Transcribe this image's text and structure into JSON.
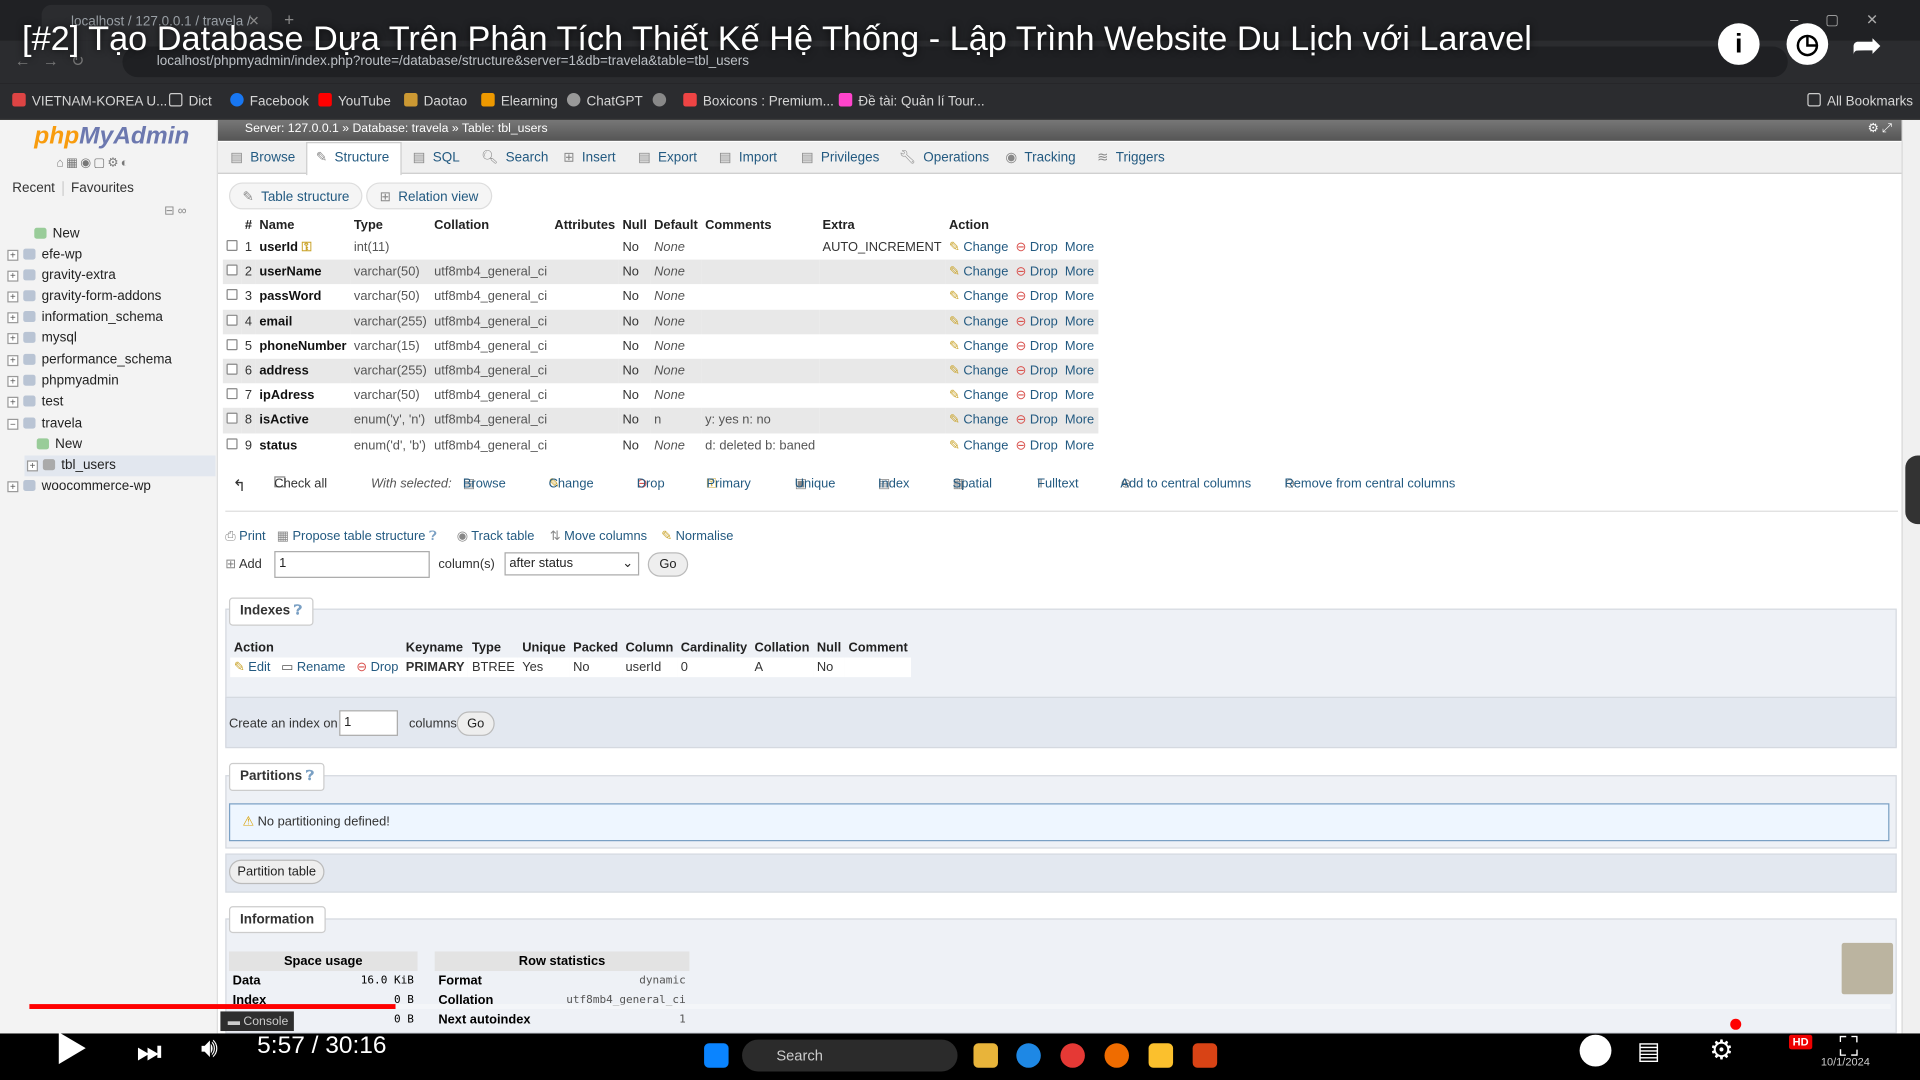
{
  "browser": {
    "tab_title": "localhost / 127.0.0.1 / travela /",
    "url": "localhost/phpmyadmin/index.php?route=/database/structure&server=1&db=travela&table=tbl_users",
    "bookmarks": [
      "VIETNAM-KOREA U...",
      "Dict",
      "Facebook",
      "YouTube",
      "Daotao",
      "Elearning",
      "ChatGPT",
      "",
      "Boxicons : Premium...",
      "Đề tài: Quản lí Tour..."
    ],
    "all_bookmarks": "All Bookmarks"
  },
  "video": {
    "title": "[#2] Tạo Database Dựa Trên Phân Tích Thiết Kế Hệ Thống - Lập Trình Website Du Lịch với Laravel",
    "time": "5:57 / 30:16",
    "progress": 0.197,
    "hd_badge": "HD"
  },
  "sidebar": {
    "logo_php": "php",
    "logo_my": "MyAdmin",
    "recent": "Recent",
    "favourites": "Favourites",
    "items": [
      {
        "label": "New"
      },
      {
        "label": "efe-wp"
      },
      {
        "label": "gravity-extra"
      },
      {
        "label": "gravity-form-addons"
      },
      {
        "label": "information_schema"
      },
      {
        "label": "mysql"
      },
      {
        "label": "performance_schema"
      },
      {
        "label": "phpmyadmin"
      },
      {
        "label": "test"
      },
      {
        "label": "travela"
      },
      {
        "label": "New"
      },
      {
        "label": "tbl_users"
      },
      {
        "label": "woocommerce-wp"
      }
    ]
  },
  "breadcrumb": {
    "server": "Server: 127.0.0.1",
    "database": "Database: travela",
    "table": "Table: tbl_users"
  },
  "tabs": [
    "Browse",
    "Structure",
    "SQL",
    "Search",
    "Insert",
    "Export",
    "Import",
    "Privileges",
    "Operations",
    "Tracking",
    "Triggers"
  ],
  "subtabs": [
    "Table structure",
    "Relation view"
  ],
  "columns_table": {
    "headers": [
      "#",
      "Name",
      "Type",
      "Collation",
      "Attributes",
      "Null",
      "Default",
      "Comments",
      "Extra",
      "Action"
    ],
    "actions": {
      "change": "Change",
      "drop": "Drop",
      "more": "More"
    },
    "rows": [
      {
        "num": "1",
        "name": "userId",
        "type": "int(11)",
        "collation": "",
        "null": "No",
        "default": "None",
        "comments": "",
        "extra": "AUTO_INCREMENT"
      },
      {
        "num": "2",
        "name": "userName",
        "type": "varchar(50)",
        "collation": "utf8mb4_general_ci",
        "null": "No",
        "default": "None",
        "comments": "",
        "extra": ""
      },
      {
        "num": "3",
        "name": "passWord",
        "type": "varchar(50)",
        "collation": "utf8mb4_general_ci",
        "null": "No",
        "default": "None",
        "comments": "",
        "extra": ""
      },
      {
        "num": "4",
        "name": "email",
        "type": "varchar(255)",
        "collation": "utf8mb4_general_ci",
        "null": "No",
        "default": "None",
        "comments": "",
        "extra": ""
      },
      {
        "num": "5",
        "name": "phoneNumber",
        "type": "varchar(15)",
        "collation": "utf8mb4_general_ci",
        "null": "No",
        "default": "None",
        "comments": "",
        "extra": ""
      },
      {
        "num": "6",
        "name": "address",
        "type": "varchar(255)",
        "collation": "utf8mb4_general_ci",
        "null": "No",
        "default": "None",
        "comments": "",
        "extra": ""
      },
      {
        "num": "7",
        "name": "ipAdress",
        "type": "varchar(50)",
        "collation": "utf8mb4_general_ci",
        "null": "No",
        "default": "None",
        "comments": "",
        "extra": ""
      },
      {
        "num": "8",
        "name": "isActive",
        "type": "enum('y', 'n')",
        "collation": "utf8mb4_general_ci",
        "null": "No",
        "default": "n",
        "comments": "y: yes n: no",
        "extra": ""
      },
      {
        "num": "9",
        "name": "status",
        "type": "enum('d', 'b')",
        "collation": "utf8mb4_general_ci",
        "null": "No",
        "default": "None",
        "comments": "d: deleted b: baned",
        "extra": ""
      }
    ]
  },
  "with_selected": {
    "check_all": "Check all",
    "label": "With selected:",
    "actions": [
      "Browse",
      "Change",
      "Drop",
      "Primary",
      "Unique",
      "Index",
      "Spatial",
      "Fulltext",
      "Add to central columns",
      "Remove from central columns"
    ]
  },
  "tools": {
    "print": "Print",
    "propose": "Propose table structure",
    "track": "Track table",
    "move": "Move columns",
    "normalise": "Normalise"
  },
  "add_columns": {
    "label": "Add",
    "value": "1",
    "suffix": "column(s)",
    "position": "after status",
    "go": "Go"
  },
  "indexes": {
    "legend": "Indexes",
    "headers": [
      "Action",
      "Keyname",
      "Type",
      "Unique",
      "Packed",
      "Column",
      "Cardinality",
      "Collation",
      "Null",
      "Comment"
    ],
    "row": {
      "edit": "Edit",
      "rename": "Rename",
      "drop": "Drop",
      "keyname": "PRIMARY",
      "type": "BTREE",
      "unique": "Yes",
      "packed": "No",
      "column": "userId",
      "cardinality": "0",
      "collation": "A",
      "null": "No",
      "comment": ""
    },
    "create_label": "Create an index on",
    "create_value": "1",
    "create_suffix": "columns",
    "go": "Go"
  },
  "partitions": {
    "legend": "Partitions",
    "notice": "No partitioning defined!",
    "button": "Partition table"
  },
  "information": {
    "legend": "Information",
    "space_usage": {
      "title": "Space usage",
      "rows": [
        {
          "k": "Data",
          "v": "16.0 KiB"
        },
        {
          "k": "Index",
          "v": "0 B"
        },
        {
          "k": "",
          "v": "0 B"
        }
      ]
    },
    "row_stats": {
      "title": "Row statistics",
      "rows": [
        {
          "k": "Format",
          "v": "dynamic"
        },
        {
          "k": "Collation",
          "v": "utf8mb4_general_ci"
        },
        {
          "k": "Next autoindex",
          "v": "1"
        }
      ]
    }
  },
  "console": "Console",
  "taskbar": {
    "search": "Search",
    "date": "10/1/2024"
  }
}
